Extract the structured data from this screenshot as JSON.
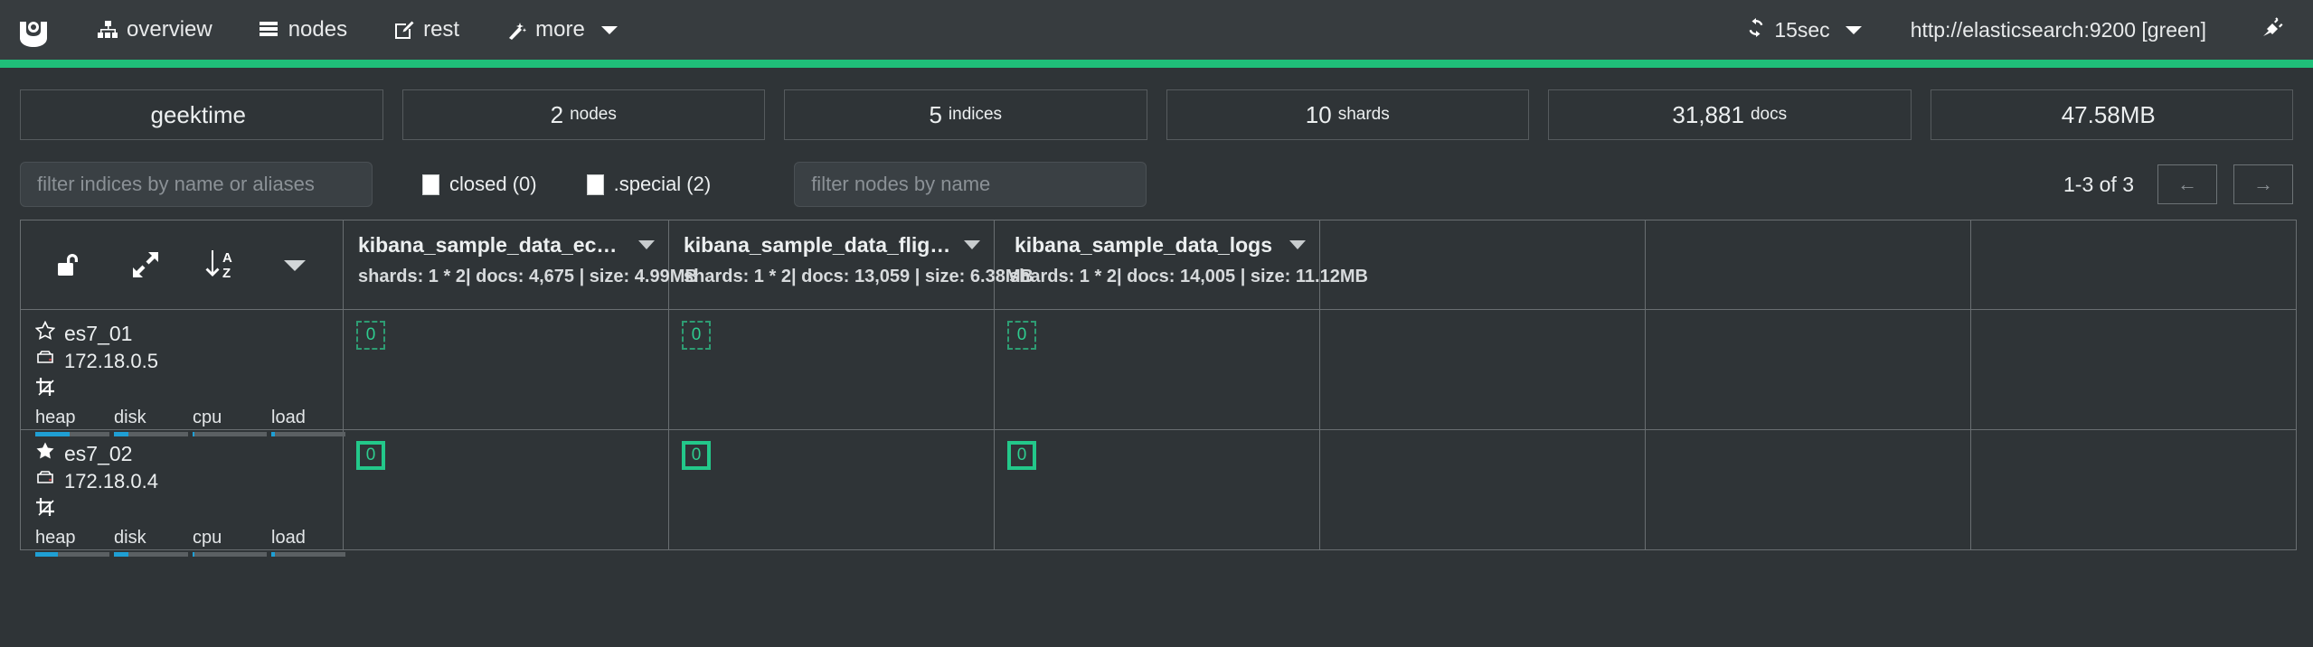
{
  "navbar": {
    "brand_icon": "cerebro-logo-icon",
    "items": [
      {
        "label": "overview",
        "icon": "sitemap-icon"
      },
      {
        "label": "nodes",
        "icon": "server-list-icon"
      },
      {
        "label": "rest",
        "icon": "edit-square-icon"
      },
      {
        "label": "more",
        "icon": "magic-wand-icon",
        "has_caret": true
      }
    ],
    "refresh": {
      "label": "15sec",
      "icon": "refresh-icon",
      "has_caret": true
    },
    "connection": "http://elasticsearch:9200 [green]",
    "disconnect_icon": "plug-icon",
    "accent_color": "#1fbf79",
    "bg_color": "#373c3f"
  },
  "stats": [
    {
      "value": "geektime",
      "unit": "",
      "name": "cluster-name"
    },
    {
      "value": "2",
      "unit": "nodes",
      "name": "nodes-count"
    },
    {
      "value": "5",
      "unit": "indices",
      "name": "indices-count"
    },
    {
      "value": "10",
      "unit": "shards",
      "name": "shards-count"
    },
    {
      "value": "31,881",
      "unit": "docs",
      "name": "docs-count"
    },
    {
      "value": "47.58MB",
      "unit": "",
      "name": "store-size"
    }
  ],
  "filters": {
    "indices_placeholder": "filter indices by name or aliases",
    "indices_value": "",
    "closed_label": "closed (0)",
    "special_label": ".special (2)",
    "nodes_placeholder": "filter nodes by name",
    "nodes_value": "",
    "pager_label": "1-3 of 3",
    "prev_label": "←",
    "next_label": "→"
  },
  "table": {
    "tools": [
      {
        "name": "unlock-icon",
        "title": "unlock"
      },
      {
        "name": "expand-arrows-icon",
        "title": "expand"
      },
      {
        "name": "sort-az-icon",
        "title": "sort a-z"
      },
      {
        "name": "chevron-down-icon",
        "title": "more"
      }
    ],
    "indices": [
      {
        "name": "kibana_sample_data_ecommerce",
        "meta": "shards: 1 * 2| docs: 4,675 | size: 4.99MB"
      },
      {
        "name": "kibana_sample_data_flights",
        "meta": "shards: 1 * 2| docs: 13,059 | size: 6.38MB"
      },
      {
        "name": "kibana_sample_data_logs",
        "meta": "shards: 1 * 2| docs: 14,005 | size: 11.12MB"
      }
    ],
    "empty_columns": 3,
    "nodes": [
      {
        "name": "es7_01",
        "ip": "172.18.0.5",
        "master": false,
        "star_icon": "star-outline-icon",
        "server_icon": "server-icon",
        "role_icon": "crop-icon",
        "meters": [
          {
            "label": "heap",
            "percent": 46
          },
          {
            "label": "disk",
            "percent": 20
          },
          {
            "label": "cpu",
            "percent": 3
          },
          {
            "label": "load",
            "percent": 5
          }
        ],
        "shards": [
          {
            "id": "0",
            "type": "replica"
          },
          {
            "id": "0",
            "type": "replica"
          },
          {
            "id": "0",
            "type": "replica"
          }
        ]
      },
      {
        "name": "es7_02",
        "ip": "172.18.0.4",
        "master": true,
        "star_icon": "star-filled-icon",
        "server_icon": "server-icon",
        "role_icon": "crop-icon",
        "meters": [
          {
            "label": "heap",
            "percent": 30
          },
          {
            "label": "disk",
            "percent": 20
          },
          {
            "label": "cpu",
            "percent": 3
          },
          {
            "label": "load",
            "percent": 5
          }
        ],
        "shards": [
          {
            "id": "0",
            "type": "primary"
          },
          {
            "id": "0",
            "type": "primary"
          },
          {
            "id": "0",
            "type": "primary"
          }
        ]
      }
    ]
  },
  "colors": {
    "primary_shard": "#23c88a",
    "replica_shard": "#2e9c73",
    "meter_fill": "#1f9fd4",
    "accent": "#1fbf79"
  }
}
